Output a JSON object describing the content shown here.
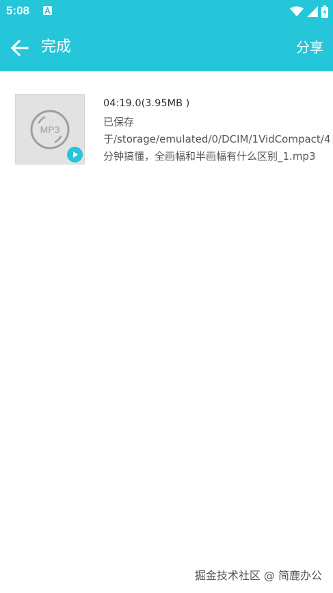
{
  "status_bar": {
    "time": "5:08",
    "icons": [
      "notification-a-icon",
      "wifi-icon",
      "signal-icon",
      "battery-charging-icon"
    ]
  },
  "app_bar": {
    "title": "完成",
    "share_label": "分享",
    "color": "#26c6da"
  },
  "file": {
    "duration_size": "04:19.0(3.95MB )",
    "saved_path": "已保存于/storage/emulated/0/DCIM/1VidCompact/4分钟搞懂，全画幅和半画幅有什么区别_1.mp3",
    "thumbnail_label": "MP3"
  },
  "watermark": "掘金技术社区 @ 简鹿办公"
}
